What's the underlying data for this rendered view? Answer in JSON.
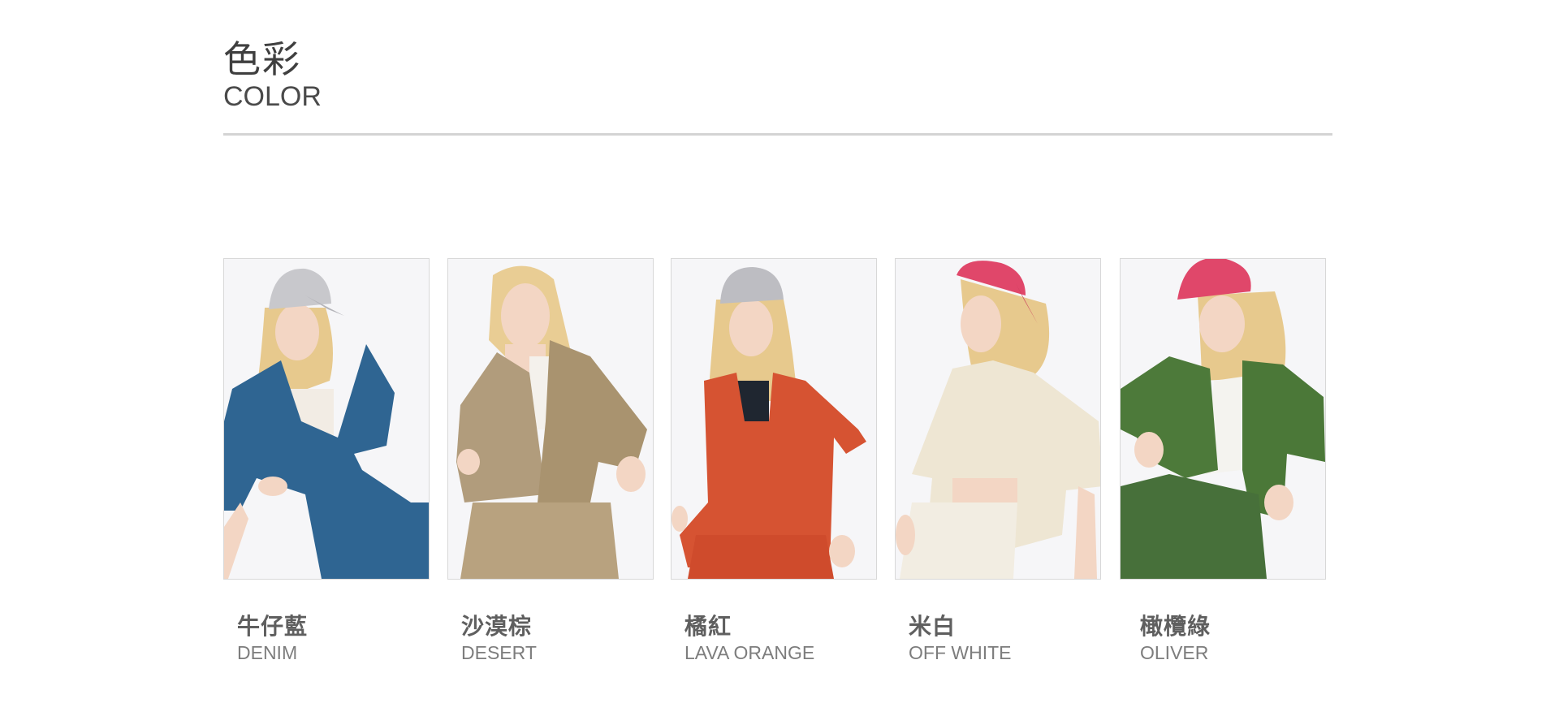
{
  "header": {
    "title_zh": "色彩",
    "title_en": "COLOR"
  },
  "colors": [
    {
      "name_zh": "牛仔藍",
      "name_en": "DENIM",
      "garment": "#2f6592",
      "cap": "#c8c8cc",
      "top": "#f2ece4"
    },
    {
      "name_zh": "沙漠棕",
      "name_en": "DESERT",
      "garment": "#b19c7c",
      "cap": "",
      "top": "#f4f1ec"
    },
    {
      "name_zh": "橘紅",
      "name_en": "LAVA ORANGE",
      "garment": "#d65332",
      "cap": "#bdbdc2",
      "top": "#1f2630"
    },
    {
      "name_zh": "米白",
      "name_en": "OFF WHITE",
      "garment": "#eee6d3",
      "cap": "#e0476a",
      "top": "#f2ede2"
    },
    {
      "name_zh": "橄欖綠",
      "name_en": "OLIVER",
      "garment": "#4d7a3a",
      "cap": "#e0476a",
      "top": "#f4f3ef"
    }
  ]
}
